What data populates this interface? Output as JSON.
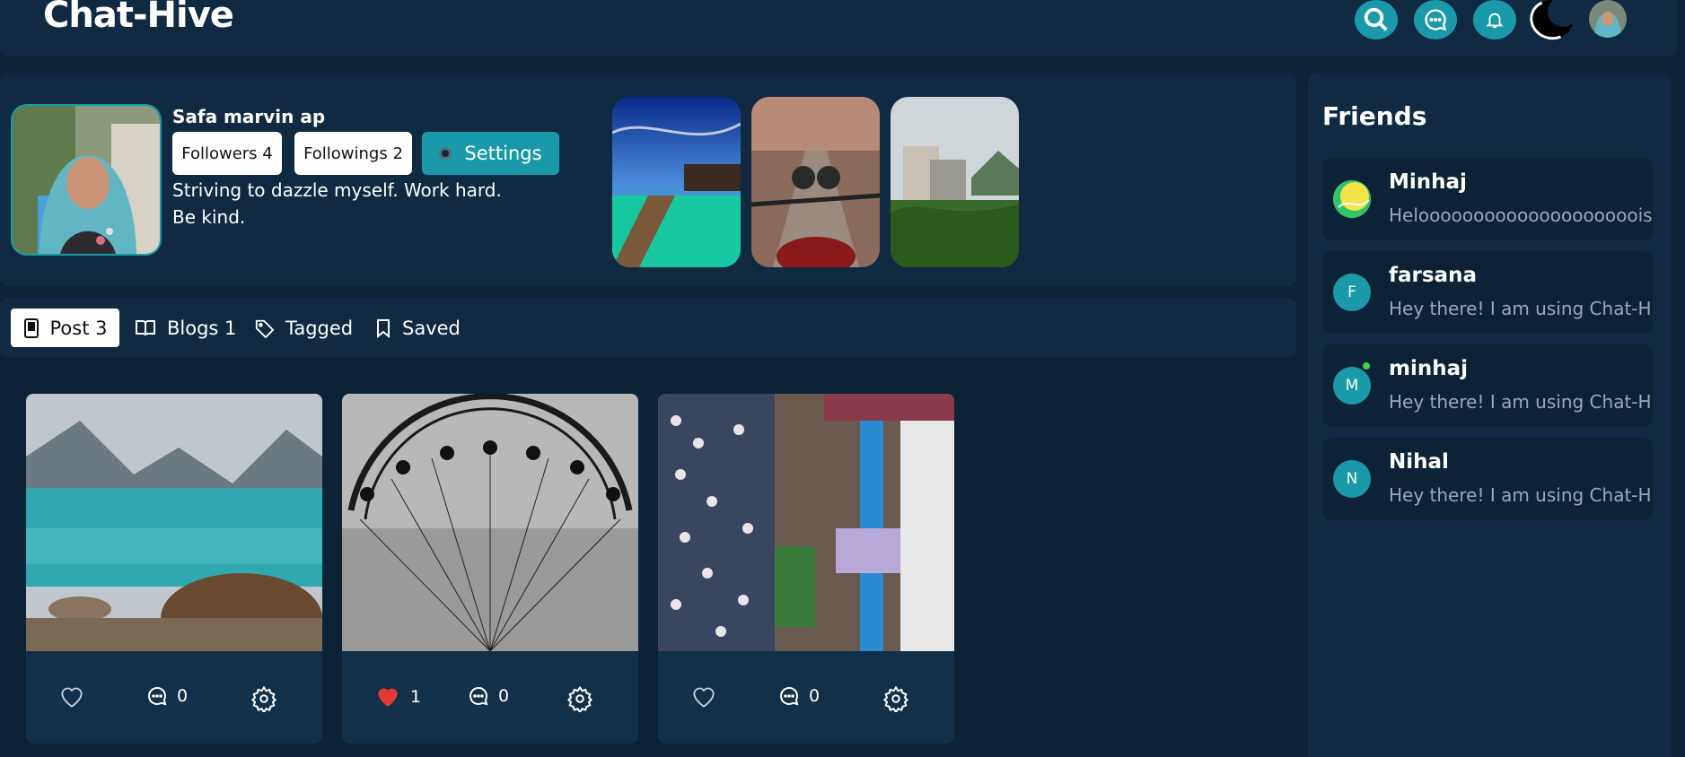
{
  "app": {
    "title": "Chat-Hive"
  },
  "header": {
    "icons": [
      "search-icon",
      "chat-icon",
      "bell-icon",
      "theme-toggle-icon",
      "avatar"
    ]
  },
  "profile": {
    "name": "Safa marvin ap",
    "followers_label": "Followers 4",
    "followings_label": "Followings 2",
    "settings_label": "Settings",
    "bio_line1": "Striving to dazzle myself. Work hard.",
    "bio_line2": "Be kind."
  },
  "tabs": [
    {
      "label": "Post 3",
      "icon": "phone-icon",
      "active": true
    },
    {
      "label": "Blogs 1",
      "icon": "book-icon",
      "active": false
    },
    {
      "label": "Tagged",
      "icon": "tag-icon",
      "active": false
    },
    {
      "label": "Saved",
      "icon": "bookmark-icon",
      "active": false
    }
  ],
  "posts": [
    {
      "likes": "",
      "comments": "0",
      "liked": false
    },
    {
      "likes": "1",
      "comments": "0",
      "liked": true
    },
    {
      "likes": "",
      "comments": "0",
      "liked": false
    }
  ],
  "friends": {
    "title": "Friends",
    "items": [
      {
        "name": "Minhaj",
        "initial": "",
        "message": "Helooooooooooooooooooooisi",
        "online": false
      },
      {
        "name": "farsana",
        "initial": "F",
        "message": "Hey there! I am using Chat-Hive",
        "online": false
      },
      {
        "name": "minhaj",
        "initial": "M",
        "message": "Hey there! I am using Chat-Hive",
        "online": true
      },
      {
        "name": "Nihal",
        "initial": "N",
        "message": "Hey there! I am using Chat-Hive",
        "online": false
      }
    ]
  },
  "colors": {
    "background": "#0c2236",
    "panel": "#0f2a42",
    "accent": "#1a9aa8",
    "like": "#e53935"
  }
}
